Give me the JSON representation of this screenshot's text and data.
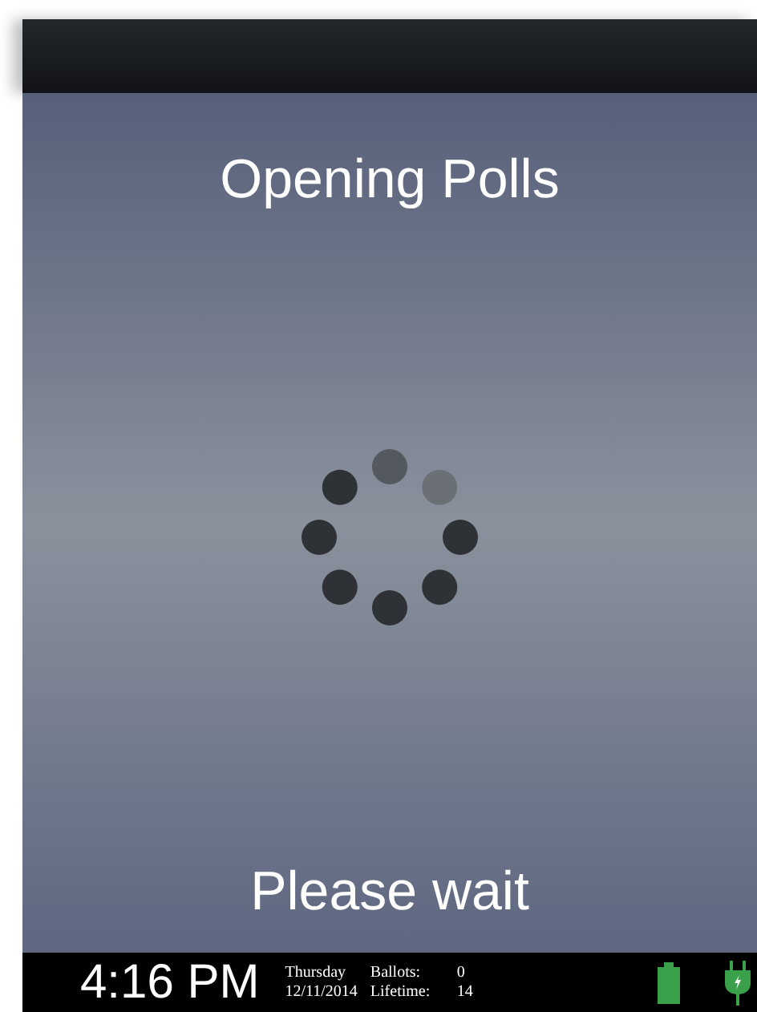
{
  "title": "Opening Polls",
  "message": "Please wait",
  "status_bar": {
    "time": "4:16 PM",
    "day": "Thursday",
    "date": "12/11/2014",
    "counters": [
      {
        "label": "Ballots:",
        "value": "0"
      },
      {
        "label": "Lifetime:",
        "value": "14"
      }
    ]
  }
}
